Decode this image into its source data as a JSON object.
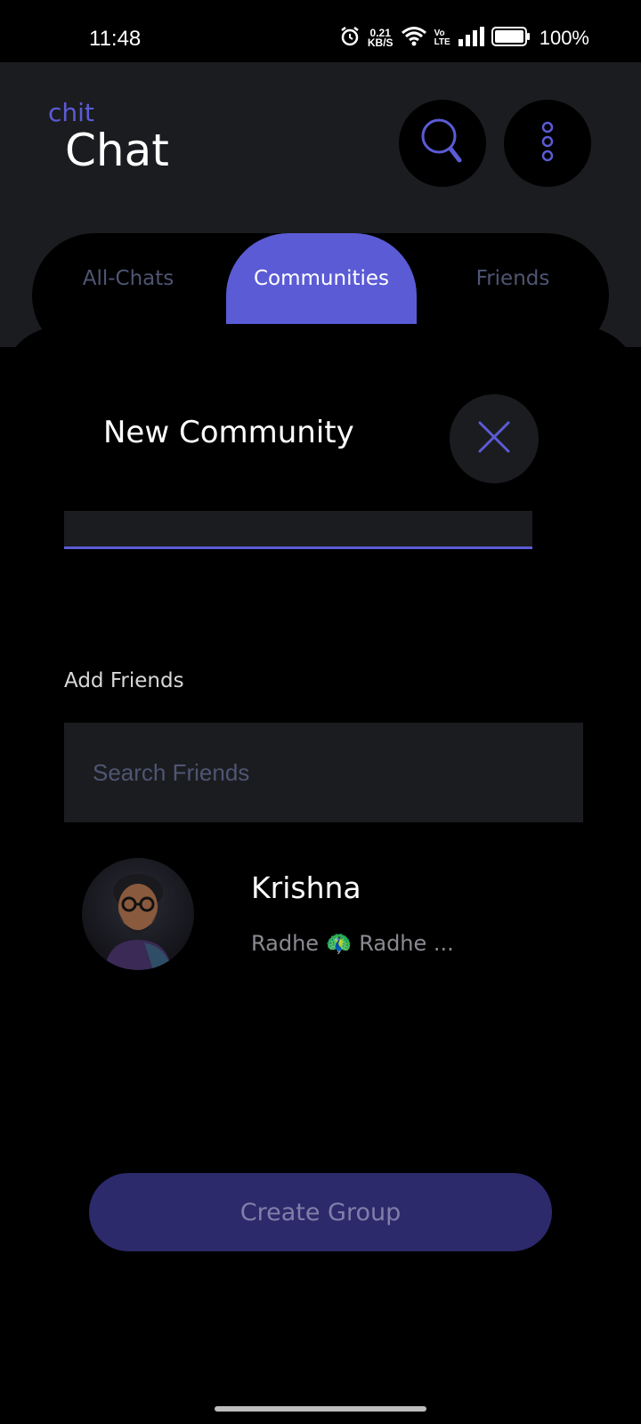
{
  "status_bar": {
    "time": "11:48",
    "net_speed_value": "0.21",
    "net_speed_unit": "KB/S",
    "volte_top": "Vo",
    "volte_bottom": "LTE",
    "battery_percent": "100%"
  },
  "header": {
    "brand_small": "chit",
    "brand_big": "Chat"
  },
  "tabs": [
    {
      "label": "All-Chats",
      "active": false
    },
    {
      "label": "Communities",
      "active": true
    },
    {
      "label": "Friends",
      "active": false
    }
  ],
  "sheet": {
    "title": "New Community",
    "section_label": "Add Friends",
    "search_placeholder": "Search Friends",
    "friends": [
      {
        "name": "Krishna",
        "status": "Radhe 🦚 Radhe ..."
      }
    ],
    "create_button_label": "Create Group"
  },
  "colors": {
    "accent": "#5b5bd6",
    "header_bg": "#1b1c1f",
    "button_bg": "#2c2a6b",
    "tab_inactive": "#4f5573"
  },
  "icons": [
    "alarm-icon",
    "wifi-icon",
    "signal-icon",
    "battery-icon",
    "search-icon",
    "more-vertical-icon",
    "close-icon"
  ]
}
